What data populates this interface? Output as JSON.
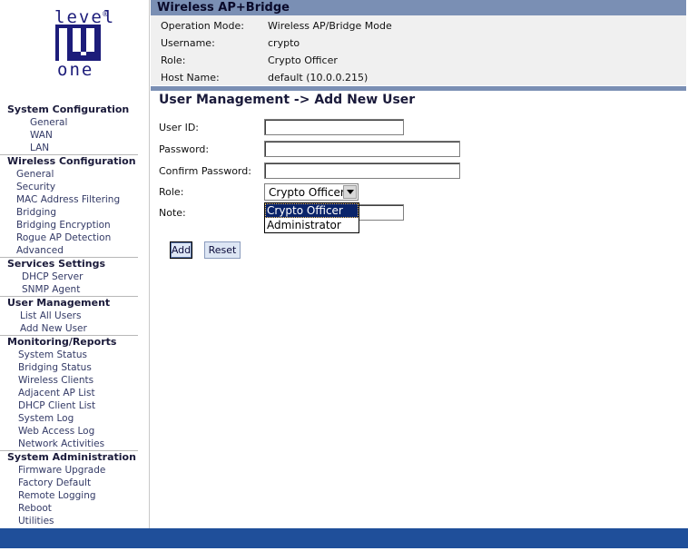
{
  "logo": {
    "top_word": "level",
    "bottom_word": "one",
    "reg_mark": "®"
  },
  "sidebar": {
    "sections": [
      {
        "title": "System Configuration",
        "items": [
          "General",
          "WAN",
          "LAN"
        ],
        "indent": 33
      },
      {
        "title": "Wireless Configuration",
        "items": [
          "General",
          "Security",
          "MAC Address Filtering",
          "Bridging",
          "Bridging Encryption",
          "Rogue AP Detection",
          "Advanced"
        ],
        "indent": 18
      },
      {
        "title": "Services Settings",
        "items": [
          "DHCP Server",
          "SNMP Agent"
        ],
        "indent": 24
      },
      {
        "title": "User Management",
        "items": [
          "List All Users",
          "Add New User"
        ],
        "indent": 22
      },
      {
        "title": "Monitoring/Reports",
        "items": [
          "System Status",
          "Bridging Status",
          "Wireless Clients",
          "Adjacent AP List",
          "DHCP Client List",
          "System Log",
          "Web Access Log",
          "Network Activities"
        ],
        "indent": 20
      },
      {
        "title": "System Administration",
        "items": [
          "Firmware Upgrade",
          "Factory Default",
          "Remote Logging",
          "Reboot",
          "Utilities"
        ],
        "indent": 20
      }
    ]
  },
  "header": {
    "title": "Wireless AP+Bridge",
    "info": [
      {
        "label": "Operation Mode:",
        "value": "Wireless AP/Bridge Mode"
      },
      {
        "label": "Username:",
        "value": "crypto"
      },
      {
        "label": "Role:",
        "value": "Crypto Officer"
      },
      {
        "label": "Host Name:",
        "value": "default (10.0.0.215)"
      }
    ]
  },
  "main": {
    "page_title": "User Management -> Add New User",
    "form": {
      "user_id_label": "User ID:",
      "user_id_value": "",
      "password_label": "Password:",
      "password_value": "",
      "confirm_label": "Confirm Password:",
      "confirm_value": "",
      "role_label": "Role:",
      "role_selected": "Crypto Officer",
      "role_options": [
        "Crypto Officer",
        "Administrator"
      ],
      "note_label": "Note:",
      "note_value": ""
    },
    "buttons": {
      "add": "Add",
      "reset": "Reset"
    }
  },
  "colors": {
    "header_bar": "#7a8fb4",
    "info_bg": "#f0f0f0",
    "footer_bar": "#1f4f9a",
    "selected_option": "#0a246a",
    "button_bg": "#dde6f4"
  }
}
